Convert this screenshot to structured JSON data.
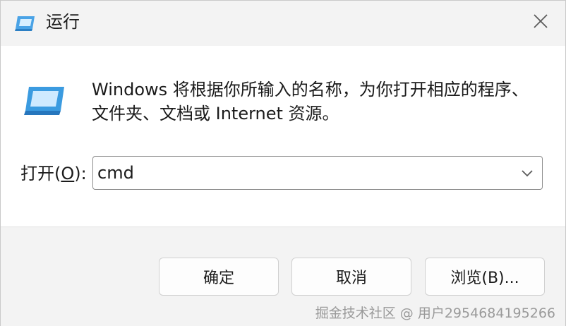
{
  "window": {
    "title": "运行",
    "icon": "run-app-icon",
    "close_icon": "close-icon"
  },
  "content": {
    "description_line1": "Windows 将根据你所输入的名称，为你打开相应的程序、",
    "description_line2": "文件夹、文档或 Internet 资源。",
    "open_label_prefix": "打开(",
    "open_label_accesskey": "O",
    "open_label_suffix": "):",
    "input_value": "cmd",
    "dropdown_icon": "chevron-down-icon"
  },
  "buttons": {
    "ok": "确定",
    "cancel": "取消",
    "browse": "浏览(B)..."
  },
  "watermark": "掘金技术社区 @ 用户2954684195266",
  "colors": {
    "background": "#f3f3f3",
    "content_bg": "#ffffff",
    "icon_blue": "#3b9be0"
  }
}
